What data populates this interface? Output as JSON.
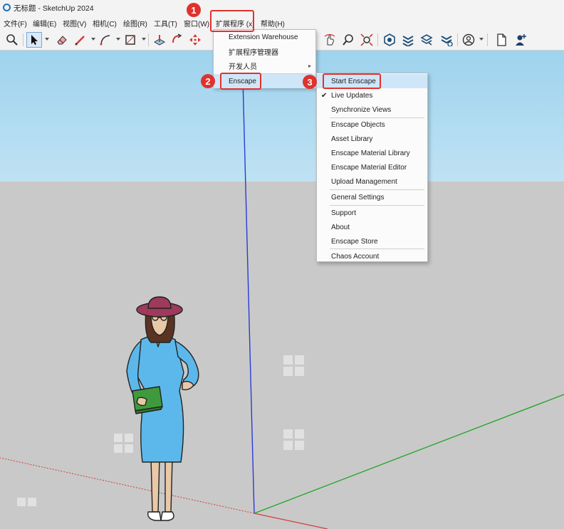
{
  "window": {
    "title": "无标题 - SketchUp 2024"
  },
  "menubar": {
    "items": [
      "文件(F)",
      "编辑(E)",
      "视图(V)",
      "相机(C)",
      "绘图(R)",
      "工具(T)",
      "窗口(W)",
      "扩展程序 (x)",
      "帮助(H)"
    ]
  },
  "extensions_menu": {
    "items": [
      "Extension Warehouse",
      "扩展程序管理器",
      "开发人员",
      "Enscape"
    ],
    "submenu_arrow": "▸"
  },
  "enscape_menu": {
    "start": "Start Enscape",
    "live_updates": "Live Updates",
    "live_updates_checked": true,
    "check_mark": "✔",
    "synchronize_views": "Synchronize Views",
    "objects": "Enscape Objects",
    "asset_library": "Asset Library",
    "material_library": "Enscape Material Library",
    "material_editor": "Enscape Material Editor",
    "upload_management": "Upload Management",
    "general_settings": "General Settings",
    "support": "Support",
    "about": "About",
    "store": "Enscape Store",
    "chaos_account": "Chaos Account"
  },
  "annotations": {
    "step1": "1",
    "step2": "2",
    "step3": "3"
  },
  "colors": {
    "accent_red": "#e0322d",
    "highlight": "#cfe6f8",
    "sky": "#9fd3ee",
    "ground": "#c9c9c9",
    "axis_blue": "#2a3bd6",
    "axis_green": "#1fa524",
    "axis_red": "#d43a3a"
  }
}
